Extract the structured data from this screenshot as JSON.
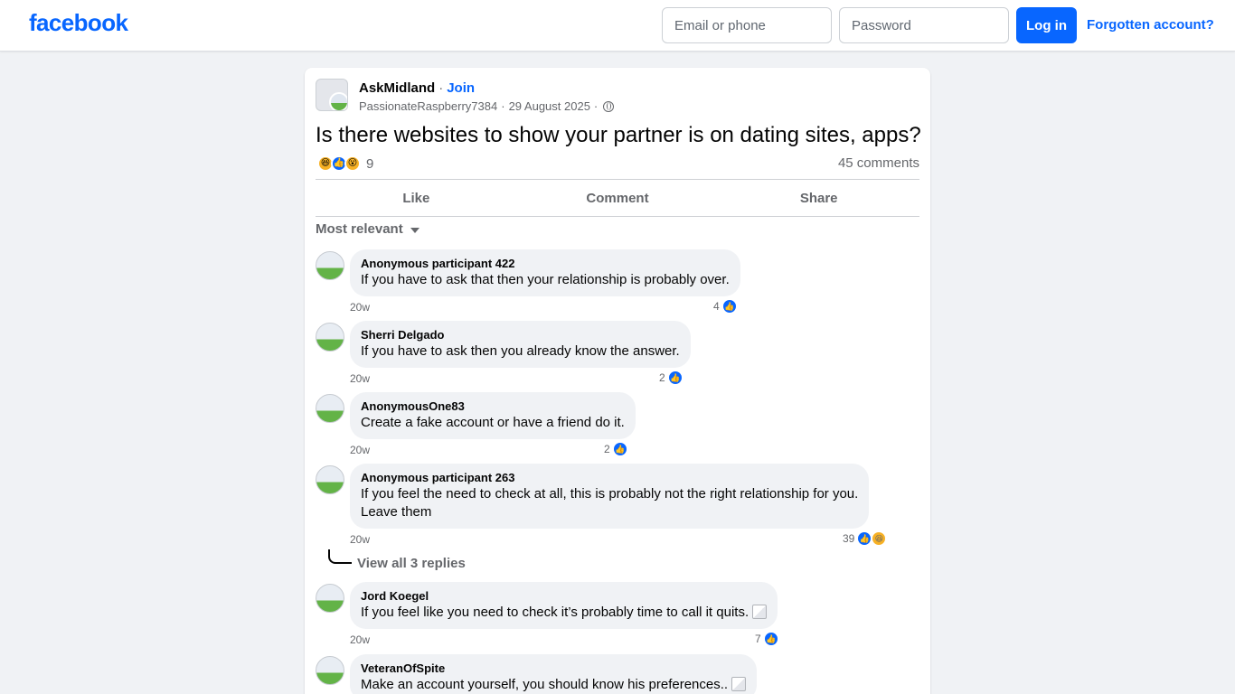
{
  "header": {
    "logo": "facebook",
    "email_placeholder": "Email or phone",
    "password_placeholder": "Password",
    "login_label": "Log in",
    "forgot_label": "Forgotten account?"
  },
  "post": {
    "group_name": "AskMidland",
    "join_label": "Join",
    "author": "PassionateRaspberry7384",
    "date": "29 August 2025",
    "title": "Is there websites to show your partner is on dating sites, apps?",
    "reaction_count": "9",
    "comments_count": "45 comments",
    "reactions": [
      "haha",
      "like",
      "wow"
    ]
  },
  "actions": {
    "like": "Like",
    "comment": "Comment",
    "share": "Share"
  },
  "sort_label": "Most relevant",
  "comments": [
    {
      "author": "Anonymous participant 422",
      "text": "If you have to ask that then your relationship is probably over.",
      "time": "20w",
      "likes": "4"
    },
    {
      "author": "Sherri Delgado",
      "text": "If you have to ask then you already know the answer.",
      "time": "20w",
      "likes": "2"
    },
    {
      "author": "AnonymousOne83",
      "text": "Create a fake account or have a friend do it.",
      "time": "20w",
      "likes": "2"
    },
    {
      "author": "Anonymous participant 263",
      "text": "If you feel the need to check at all, this is probably not the right relationship for you.",
      "text2": "Leave them",
      "time": "20w",
      "likes": "39"
    },
    {
      "author": "Jord Koegel",
      "text": "If you feel like you need to check it’s probably time to call it quits.",
      "time": "20w",
      "likes": "7"
    },
    {
      "author": "VeteranOfSpite",
      "text": "Make an account yourself, you should know his preferences.."
    }
  ],
  "view_replies": "View all 3 replies"
}
